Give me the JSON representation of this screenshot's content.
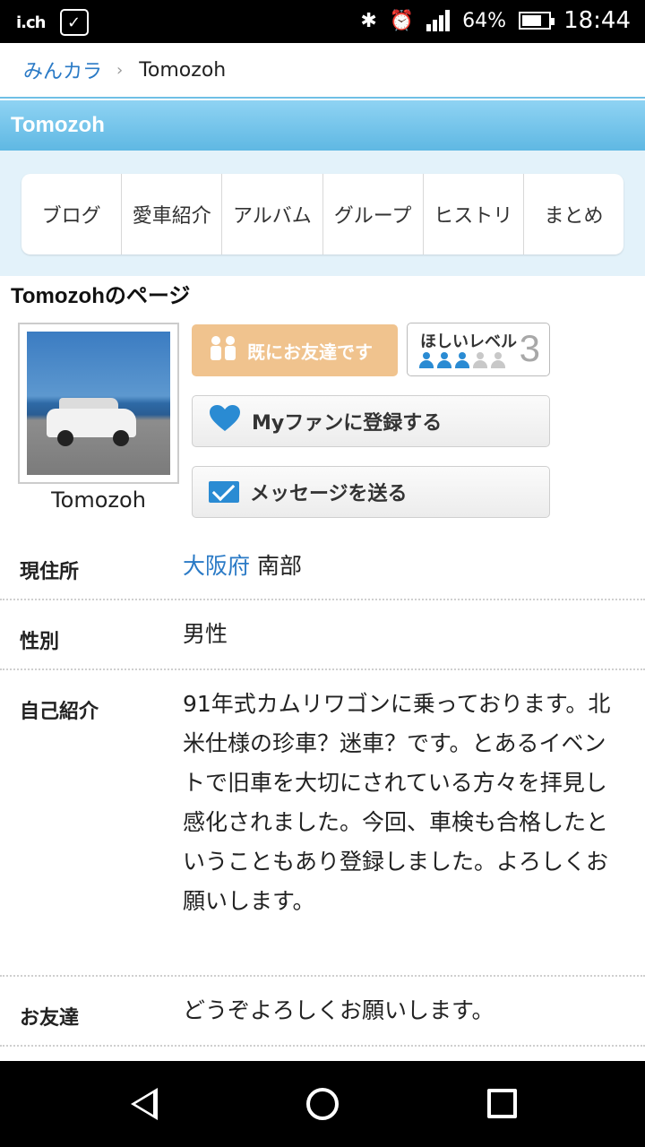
{
  "status_bar": {
    "left_label": "i.ch",
    "battery_percent": "64%",
    "battery_level": 0.64,
    "time": "18:44",
    "network": "LTE"
  },
  "breadcrumb": {
    "root": "みんカラ",
    "separator": "›",
    "current": "Tomozoh"
  },
  "header": {
    "title": "Tomozoh"
  },
  "tabs": [
    {
      "label": "ブログ"
    },
    {
      "label": "愛車紹介"
    },
    {
      "label": "アルバム"
    },
    {
      "label": "グループ"
    },
    {
      "label": "ヒストリ"
    },
    {
      "label": "まとめ"
    }
  ],
  "page_title": "Tomozohのページ",
  "profile": {
    "name": "Tomozoh",
    "friend_button": "既にお友達です",
    "level": {
      "label": "ほしいレベル",
      "value": "3",
      "max": 5
    },
    "fan_button": "Myファンに登録する",
    "message_button": "メッセージを送る"
  },
  "details": {
    "residence": {
      "label": "現住所",
      "link": "大阪府",
      "rest": "南部"
    },
    "gender": {
      "label": "性別",
      "value": "男性"
    },
    "intro": {
      "label": "自己紹介",
      "value": "91年式カムリワゴンに乗っております。北米仕様の珍車？迷車？です。とあるイベントで旧車を大切にされている方々を拝見し感化されました。今回、車検も合格したということもあり登録しました。よろしくお願いします。"
    },
    "friends": {
      "label": "お友達",
      "value": "どうぞよろしくお願いします。"
    }
  },
  "colors": {
    "accent_blue": "#2a7ac6",
    "header_band": "#6fc0e6",
    "friend_button": "#f0c38e",
    "level_active": "#2a8bd3",
    "level_inactive": "#c8c8c8"
  }
}
